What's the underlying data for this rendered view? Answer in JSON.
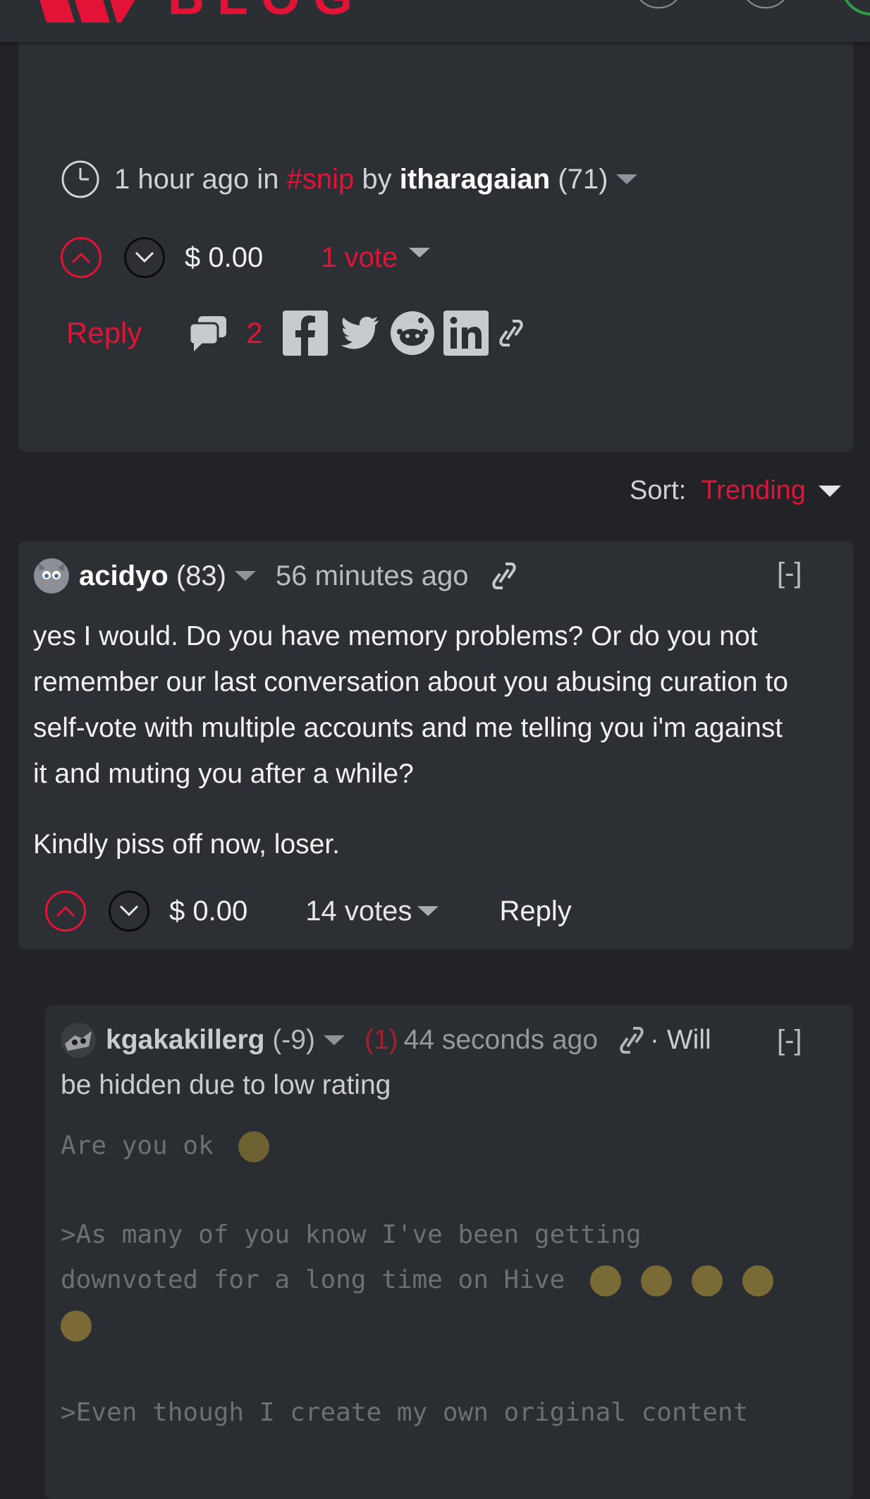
{
  "header": {
    "logo_text": "BLOG",
    "brand_color": "#e31337"
  },
  "post": {
    "time": "1 hour ago in",
    "tag": "#snip",
    "by": "by",
    "author": "itharagaian",
    "reputation": "(71)",
    "payout": "$ 0.00",
    "votes": "1 vote",
    "reply_label": "Reply",
    "comment_count": "2"
  },
  "sort": {
    "label": "Sort:",
    "value": "Trending"
  },
  "comments": [
    {
      "author": "acidyo",
      "reputation": "(83)",
      "time": "56 minutes ago",
      "collapse": "[-]",
      "body": [
        "yes I would. Do you have memory problems? Or do you not",
        "remember our last conversation about you abusing curation to",
        "self-vote with multiple accounts and me telling you i'm against",
        "it and muting you after a while?"
      ],
      "body2": "Kindly piss off now, loser.",
      "payout": "$ 0.00",
      "votes": "14 votes",
      "reply_label": "Reply"
    },
    {
      "author": "kgakakillerg",
      "reputation": "(-9)",
      "rating": "(1)",
      "time": "44 seconds ago",
      "notice_a": "· Will",
      "notice_b": "be hidden due to low rating",
      "collapse": "[-]",
      "line1": "Are you ok ",
      "line2": ">As many of you know I've been getting",
      "line3": "downvoted for a long time on Hive ",
      "line4": ">Even though I create my own original content"
    }
  ]
}
